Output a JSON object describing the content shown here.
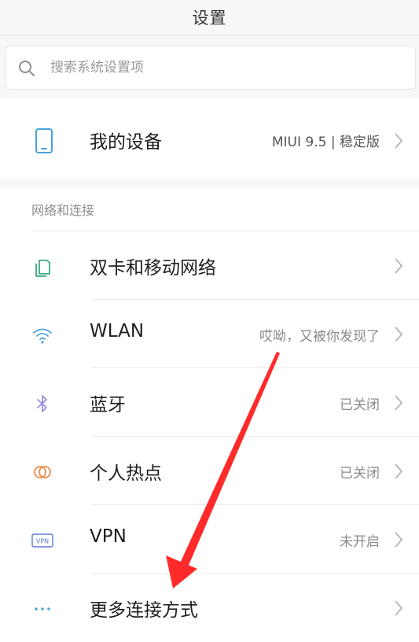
{
  "header": {
    "title": "设置"
  },
  "search": {
    "placeholder": "搜索系统设置项",
    "value": ""
  },
  "device": {
    "label": "我的设备",
    "value": "MIUI 9.5 | 稳定版",
    "icon": "phone-icon"
  },
  "section": {
    "title": "网络和连接"
  },
  "items": [
    {
      "label": "双卡和移动网络",
      "value": "",
      "icon": "sim-card-icon"
    },
    {
      "label": "WLAN",
      "value": "哎呦，又被你发现了",
      "icon": "wifi-icon"
    },
    {
      "label": "蓝牙",
      "value": "已关闭",
      "icon": "bluetooth-icon"
    },
    {
      "label": "个人热点",
      "value": "已关闭",
      "icon": "hotspot-icon"
    },
    {
      "label": "VPN",
      "value": "未开启",
      "icon": "vpn-icon",
      "icon_text": "VPN"
    },
    {
      "label": "更多连接方式",
      "value": "",
      "icon": "more-dots-icon"
    }
  ],
  "colors": {
    "icon_accent": "#4aa3d8",
    "sim_icon": "#3aaa7e",
    "bluetooth_icon": "#9b8fdc",
    "hotspot_icon": "#f08a4b",
    "vpn_icon": "#5b7bd5",
    "annotation_arrow": "#ff2a2a"
  }
}
